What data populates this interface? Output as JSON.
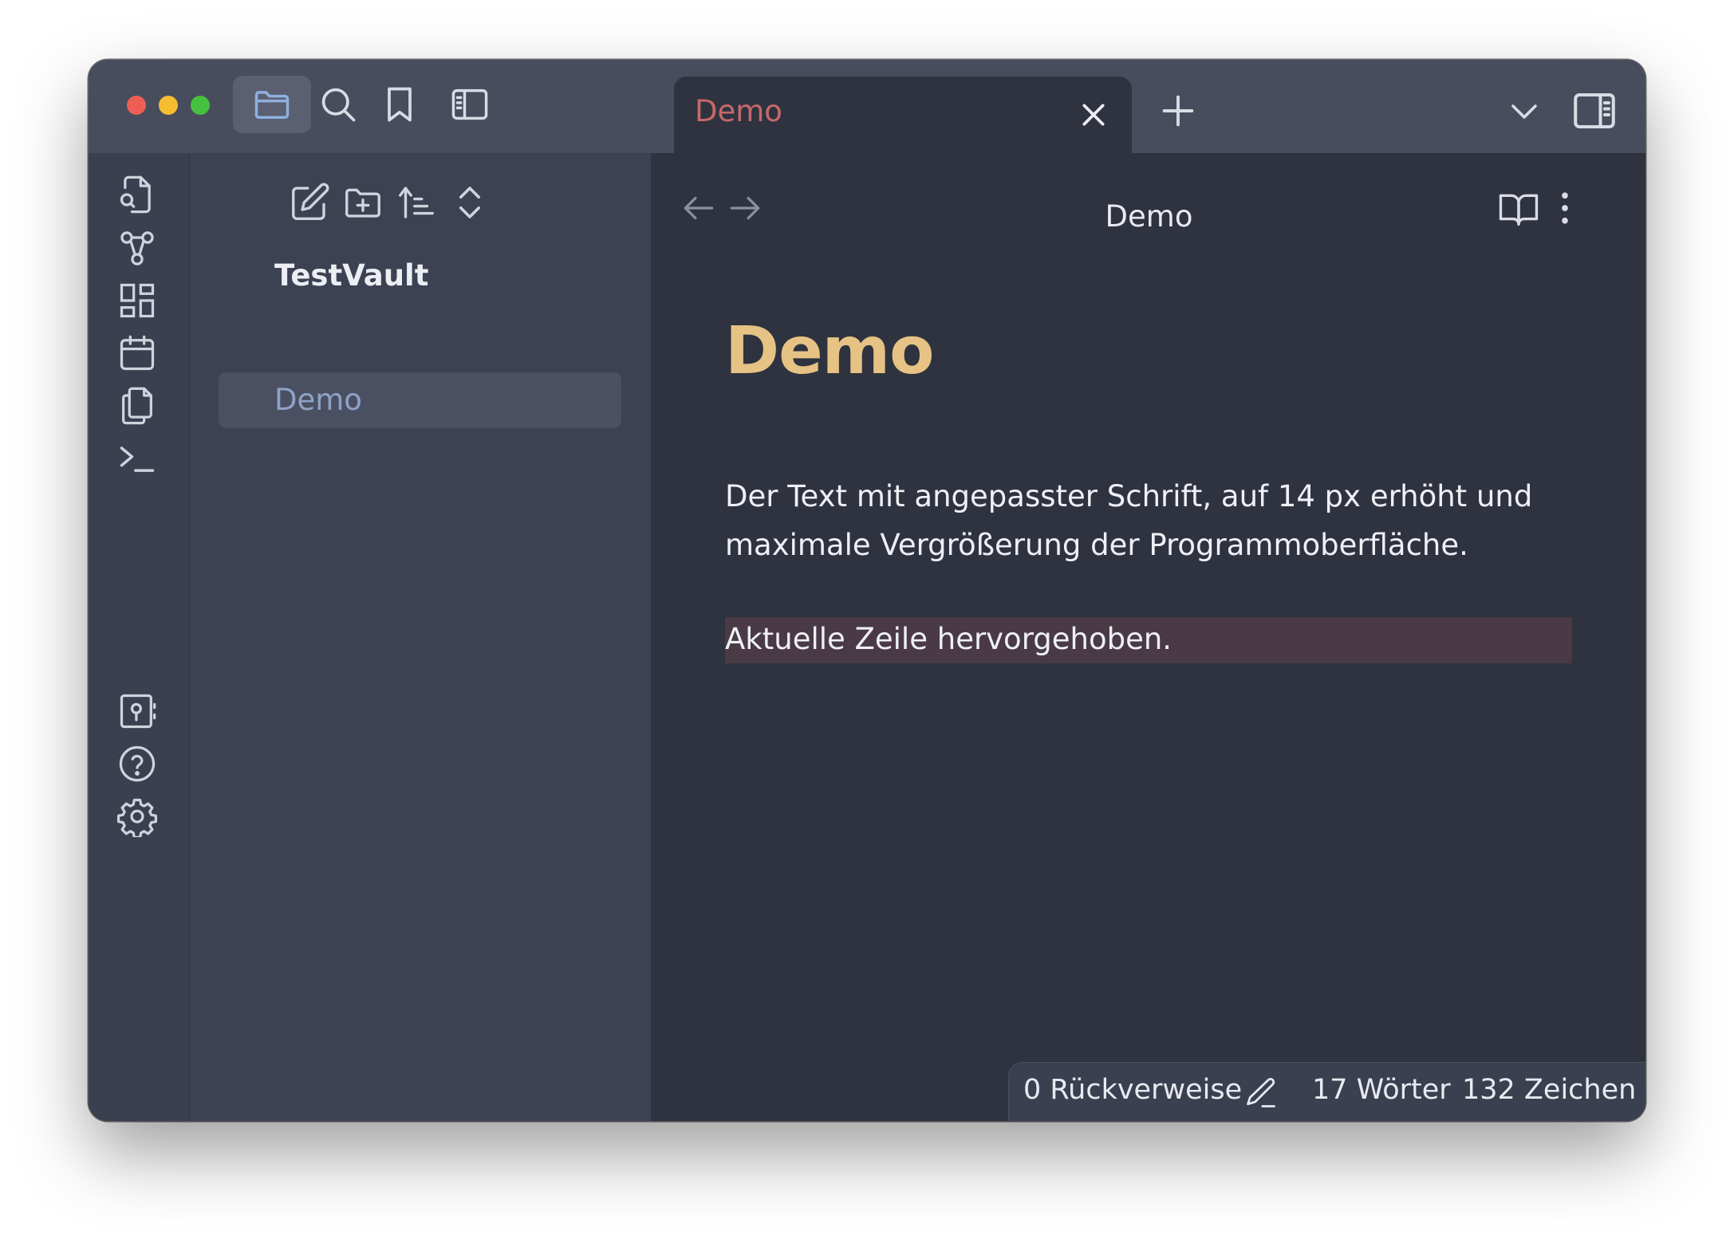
{
  "window": {
    "tab_title": "Demo",
    "editor_title": "Demo"
  },
  "titlebar": {
    "buttons": [
      "folder-icon",
      "search-icon",
      "bookmark-icon",
      "sidebar-left-icon"
    ],
    "new_tab_icon": "plus-icon",
    "tab_list_icon": "chevron-down-icon",
    "right_sidebar_icon": "sidebar-right-icon"
  },
  "ribbon": {
    "icons": [
      "quick-switcher-icon",
      "graph-view-icon",
      "canvas-icon",
      "daily-note-icon",
      "templates-icon",
      "command-palette-icon",
      "vault-switcher-icon",
      "help-icon",
      "settings-icon"
    ]
  },
  "explorer": {
    "actions": [
      "new-note-icon",
      "new-folder-icon",
      "sort-icon",
      "collapse-all-icon"
    ],
    "vault_name": "TestVault",
    "files": [
      {
        "name": "Demo",
        "selected": true
      }
    ]
  },
  "document": {
    "heading": "Demo",
    "paragraph": "Der Text mit angepasster Schrift, auf 14 px erhöht und maximale Vergrößerung der Programmoberfläche.",
    "current_line": "Aktuelle Zeile hervorgehoben."
  },
  "statusbar": {
    "backlinks": "0 Rückverweise",
    "words": "17 Wörter",
    "characters": "132 Zeichen"
  },
  "colors": {
    "accent_tab": "#c7686a",
    "heading": "#e6c384",
    "selected_file": "#8fa2c6",
    "current_line_bg": "#4a3a45"
  }
}
